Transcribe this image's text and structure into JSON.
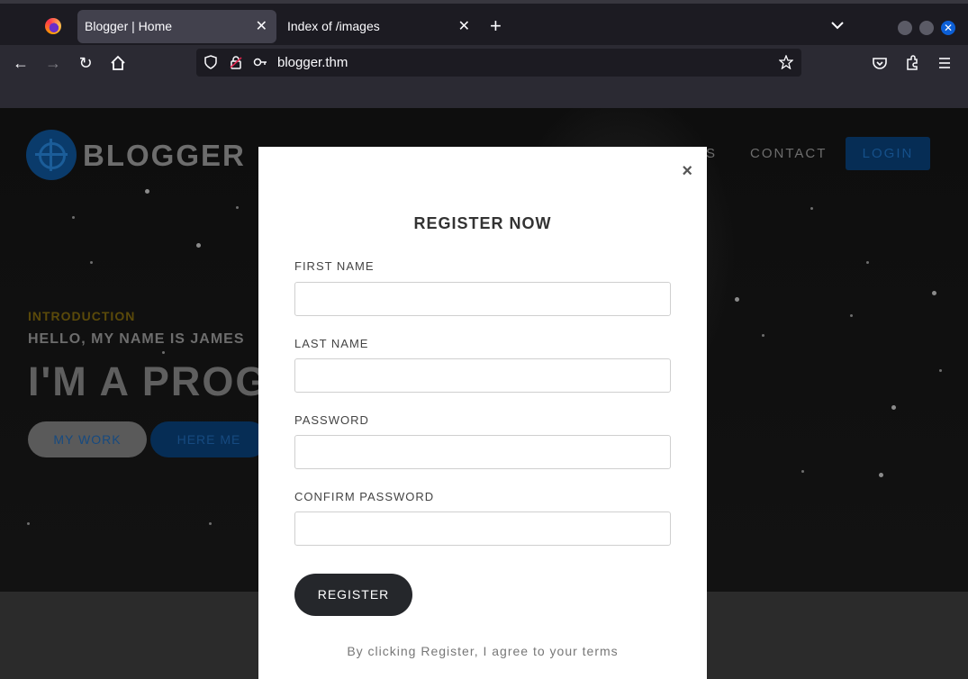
{
  "browser": {
    "tabs": [
      {
        "title": "Blogger | Home",
        "active": true
      },
      {
        "title": "Index of /images",
        "active": false
      }
    ],
    "url": "blogger.thm",
    "accent_color": "#0c5fd6"
  },
  "site": {
    "logo_name": "BLOGGER",
    "nav": {
      "partial_item": "S",
      "contact": "CONTACT",
      "login": "LOGIN"
    },
    "hero": {
      "intro_label": "INTRODUCTION",
      "hello": "HELLO, MY NAME IS JAMES",
      "headline_visible": "I'M A PROG",
      "buttons": {
        "my_work": "MY WORK",
        "hire_me": "HERE ME"
      }
    }
  },
  "modal": {
    "close_symbol": "×",
    "title": "REGISTER NOW",
    "fields": [
      {
        "label": "FIRST NAME",
        "value": ""
      },
      {
        "label": "LAST NAME",
        "value": ""
      },
      {
        "label": "PASSWORD",
        "value": ""
      },
      {
        "label": "CONFIRM PASSWORD",
        "value": ""
      }
    ],
    "submit_label": "REGISTER",
    "terms": "By clicking Register, I agree to your terms"
  }
}
